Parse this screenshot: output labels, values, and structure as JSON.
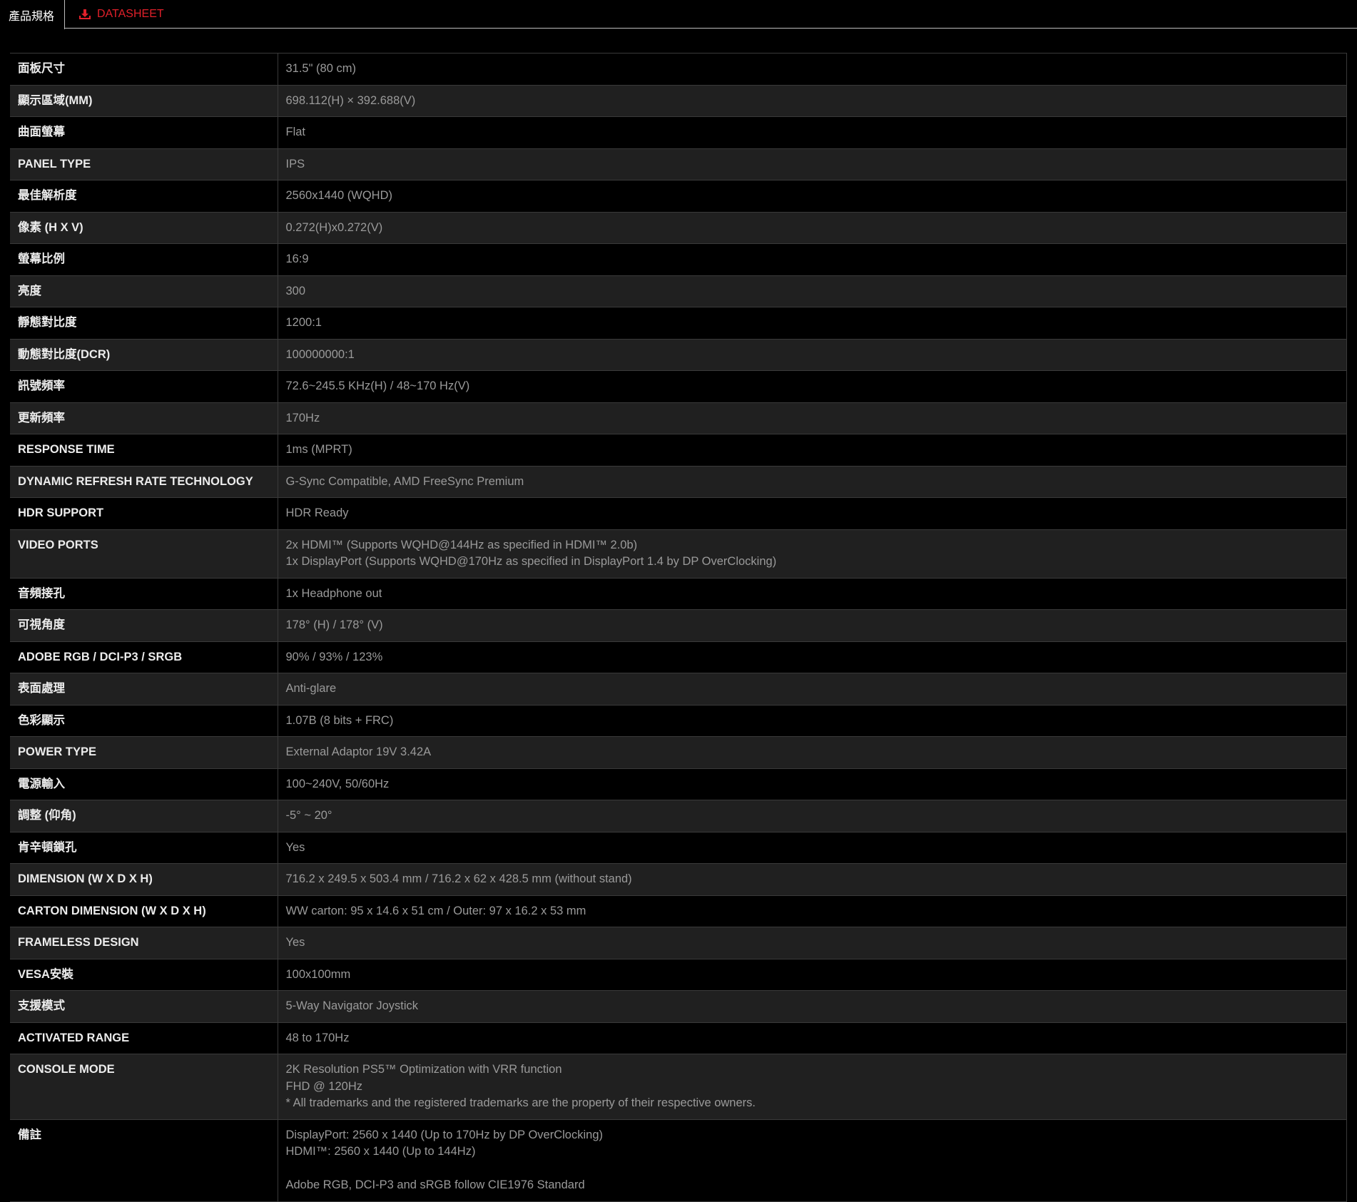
{
  "tabs": {
    "specs_label": "產品規格",
    "datasheet_label": "DATASHEET",
    "datasheet_icon": "download-icon",
    "accent_color": "#e0202a"
  },
  "specs": [
    {
      "label": "面板尺寸",
      "value": "31.5\" (80 cm)"
    },
    {
      "label": "顯示區域(MM)",
      "value": "698.112(H) × 392.688(V)"
    },
    {
      "label": "曲面螢幕",
      "value": "Flat"
    },
    {
      "label": "PANEL TYPE",
      "value": "IPS"
    },
    {
      "label": "最佳解析度",
      "value": "2560x1440 (WQHD)"
    },
    {
      "label": "像素 (H X V)",
      "value": "0.272(H)x0.272(V)"
    },
    {
      "label": "螢幕比例",
      "value": "16:9"
    },
    {
      "label": "亮度",
      "value": "300"
    },
    {
      "label": "靜態對比度",
      "value": "1200:1"
    },
    {
      "label": "動態對比度(DCR)",
      "value": "100000000:1"
    },
    {
      "label": "訊號頻率",
      "value": "72.6~245.5 KHz(H) / 48~170 Hz(V)"
    },
    {
      "label": "更新頻率",
      "value": "170Hz"
    },
    {
      "label": "RESPONSE TIME",
      "value": "1ms (MPRT)"
    },
    {
      "label": "DYNAMIC REFRESH RATE TECHNOLOGY",
      "value": "G-Sync Compatible, AMD FreeSync Premium"
    },
    {
      "label": "HDR SUPPORT",
      "value": "HDR Ready"
    },
    {
      "label": "VIDEO PORTS",
      "value": "2x HDMI™ (Supports WQHD@144Hz as specified in HDMI™ 2.0b)\n1x DisplayPort (Supports WQHD@170Hz as specified in DisplayPort 1.4 by DP OverClocking)"
    },
    {
      "label": "音頻接孔",
      "value": "1x Headphone out"
    },
    {
      "label": "可視角度",
      "value": "178° (H) / 178° (V)"
    },
    {
      "label": "ADOBE RGB / DCI-P3 / SRGB",
      "value": "90% / 93% / 123%"
    },
    {
      "label": "表面處理",
      "value": "Anti-glare"
    },
    {
      "label": "色彩顯示",
      "value": "1.07B (8 bits + FRC)"
    },
    {
      "label": "POWER TYPE",
      "value": "External Adaptor 19V 3.42A"
    },
    {
      "label": "電源輸入",
      "value": "100~240V, 50/60Hz"
    },
    {
      "label": "調整 (仰角)",
      "value": "-5° ~ 20°"
    },
    {
      "label": "肯辛頓鎖孔",
      "value": "Yes"
    },
    {
      "label": "DIMENSION (W X D X H)",
      "value": "716.2 x 249.5 x 503.4 mm / 716.2 x 62 x 428.5 mm (without stand)"
    },
    {
      "label": "CARTON DIMENSION (W X D X H)",
      "value": "WW carton: 95 x 14.6 x 51 cm / Outer: 97 x 16.2 x 53 mm"
    },
    {
      "label": "FRAMELESS DESIGN",
      "value": "Yes"
    },
    {
      "label": "VESA安裝",
      "value": "100x100mm"
    },
    {
      "label": "支援模式",
      "value": "5-Way Navigator Joystick"
    },
    {
      "label": "ACTIVATED RANGE",
      "value": "48 to 170Hz"
    },
    {
      "label": "CONSOLE MODE",
      "value": "2K Resolution PS5™ Optimization with VRR function\nFHD @ 120Hz\n* All trademarks and the registered trademarks are the property of their respective owners."
    },
    {
      "label": "備註",
      "value": "DisplayPort: 2560 x 1440 (Up to 170Hz by DP OverClocking)\nHDMI™: 2560 x 1440 (Up to 144Hz)\n\nAdobe RGB, DCI-P3 and sRGB follow CIE1976 Standard"
    }
  ]
}
